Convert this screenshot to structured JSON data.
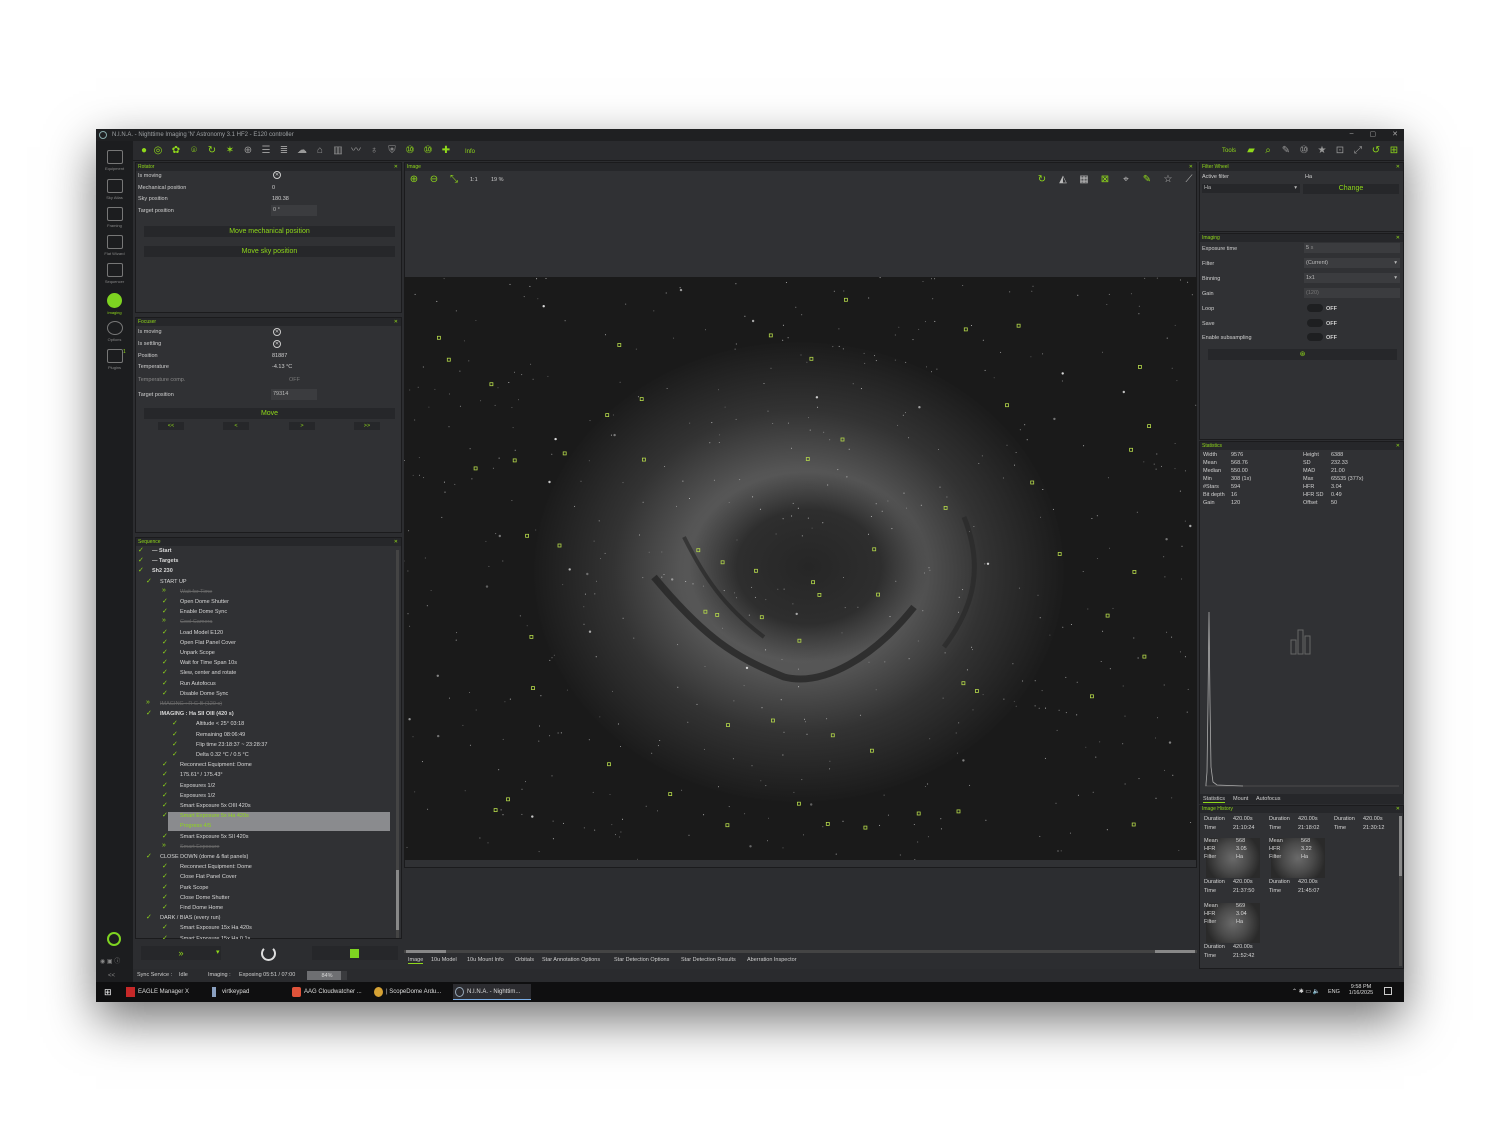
{
  "window": {
    "title": "N.I.N.A. - Nighttime Imaging 'N' Astronomy 3.1 HF2  -  E120 controller"
  },
  "sidebar": {
    "items": [
      {
        "label": "Equipment",
        "icon": "camera-icon"
      },
      {
        "label": "Sky Atlas",
        "icon": "atlas-icon"
      },
      {
        "label": "Framing",
        "icon": "framing-icon"
      },
      {
        "label": "Flat Wizard",
        "icon": "flat-icon"
      },
      {
        "label": "Sequencer",
        "icon": "sequencer-icon"
      },
      {
        "label": "Imaging",
        "icon": "imaging-icon"
      },
      {
        "label": "Options",
        "icon": "gear-icon"
      },
      {
        "label": "Plugins",
        "icon": "puzzle-icon"
      }
    ],
    "plugins_badge": "1"
  },
  "toolbar": {
    "info_label": "Info",
    "tools_label": "Tools"
  },
  "rotator": {
    "title": "Rotator",
    "is_moving_label": "Is moving",
    "mechanical_label": "Mechanical position",
    "mechanical_value": "0",
    "sky_label": "Sky position",
    "sky_value": "180.38",
    "target_label": "Target position",
    "target_value": "0",
    "target_unit": "°",
    "move_mech_btn": "Move mechanical position",
    "move_sky_btn": "Move sky position"
  },
  "focuser": {
    "title": "Focuser",
    "is_moving_label": "Is moving",
    "is_settling_label": "Is settling",
    "position_label": "Position",
    "position_value": "81887",
    "temp_label": "Temperature",
    "temp_value": "-4.13 °C",
    "temp_comp_label": "Temperature comp.",
    "temp_comp_value": "OFF",
    "target_label": "Target position",
    "target_value": "79314",
    "move_btn": "Move",
    "steps": [
      "<<",
      "<",
      ">",
      ">>"
    ]
  },
  "sequence": {
    "title": "Sequence",
    "items": [
      {
        "text": "Start",
        "indent": 0,
        "style": "bold"
      },
      {
        "text": "Targets",
        "indent": 0,
        "style": "bold"
      },
      {
        "text": "Sh2 230",
        "indent": 1,
        "style": "bold"
      },
      {
        "text": "START UP",
        "indent": 2,
        "style": ""
      },
      {
        "text": "Wait for Time",
        "indent": 3,
        "style": "dis"
      },
      {
        "text": "Open Dome Shutter",
        "indent": 3,
        "style": ""
      },
      {
        "text": "Enable Dome Sync",
        "indent": 3,
        "style": ""
      },
      {
        "text": "Cool Camera",
        "indent": 3,
        "style": "dis"
      },
      {
        "text": "Load Model E120",
        "indent": 3,
        "style": ""
      },
      {
        "text": "Open Flat Panel Cover",
        "indent": 3,
        "style": ""
      },
      {
        "text": "Unpark Scope",
        "indent": 3,
        "style": ""
      },
      {
        "text": "Wait for Time Span  10s",
        "indent": 3,
        "style": ""
      },
      {
        "text": "Slew, center and rotate",
        "indent": 3,
        "style": ""
      },
      {
        "text": "Run Autofocus",
        "indent": 3,
        "style": ""
      },
      {
        "text": "Disable Dome Sync",
        "indent": 3,
        "style": ""
      },
      {
        "text": "IMAGING : R G B  (120 s)",
        "indent": 2,
        "style": "dis"
      },
      {
        "text": "IMAGING : Ha SII OIII  (420 s)",
        "indent": 2,
        "style": "bold"
      },
      {
        "text": "Altitude < 25°  03:18",
        "indent": 4,
        "style": ""
      },
      {
        "text": "Remaining  08:06:49",
        "indent": 4,
        "style": ""
      },
      {
        "text": "Flip time  23:18:37 ~ 23:28:37",
        "indent": 4,
        "style": ""
      },
      {
        "text": "Delta  0.32 °C / 0.5 °C",
        "indent": 4,
        "style": ""
      },
      {
        "text": "Reconnect Equipment: Dome",
        "indent": 3,
        "style": ""
      },
      {
        "text": "175.61° / 175.43°",
        "indent": 3,
        "style": ""
      },
      {
        "text": "Exposures  1/2",
        "indent": 3,
        "style": ""
      },
      {
        "text": "Exposures  1/2",
        "indent": 3,
        "style": ""
      },
      {
        "text": "Smart Exposure  5x  OIII  420s",
        "indent": 3,
        "style": ""
      },
      {
        "text": "Smart Exposure  5x  Ha  420s",
        "indent": 3,
        "style": "hl"
      },
      {
        "text": "Progress  4/5",
        "indent": 3,
        "style": "hl2"
      },
      {
        "text": "Smart Exposure  5x  SII  420s",
        "indent": 3,
        "style": ""
      },
      {
        "text": "Smart Exposure",
        "indent": 3,
        "style": "dis"
      },
      {
        "text": "CLOSE DOWN (dome & flat panels)",
        "indent": 2,
        "style": ""
      },
      {
        "text": "Reconnect Equipment: Dome",
        "indent": 3,
        "style": ""
      },
      {
        "text": "Close Flat Panel Cover",
        "indent": 3,
        "style": ""
      },
      {
        "text": "Park Scope",
        "indent": 3,
        "style": ""
      },
      {
        "text": "Close Dome Shutter",
        "indent": 3,
        "style": ""
      },
      {
        "text": "Find Dome Home",
        "indent": 3,
        "style": ""
      },
      {
        "text": "DARK / BIAS (every run)",
        "indent": 2,
        "style": ""
      },
      {
        "text": "Smart Exposure  15x  Ha  420s",
        "indent": 3,
        "style": ""
      },
      {
        "text": "Smart Exposure  15x  Ha  0.1s",
        "indent": 3,
        "style": ""
      }
    ]
  },
  "image_panel": {
    "title": "Image",
    "zoom_1to1": "1:1",
    "zoom_level": "19 %",
    "tabs": [
      "Image",
      "10u Model",
      "10u Mount Info",
      "Orbitals",
      "Star Annotation Options",
      "Star Detection Options",
      "Star Detection Results",
      "Aberration Inspector"
    ]
  },
  "filter_wheel": {
    "title": "Filter Wheel",
    "active_label": "Active filter",
    "active_value": "Ha",
    "select_value": "Ha",
    "change_btn": "Change"
  },
  "imaging": {
    "title": "Imaging",
    "exposure_label": "Exposure time",
    "exposure_value": "5",
    "exposure_unit": "s",
    "filter_label": "Filter",
    "filter_value": "(Current)",
    "binning_label": "Binning",
    "binning_value": "1x1",
    "gain_label": "Gain",
    "gain_value": "(120)",
    "loop_label": "Loop",
    "loop_value": "OFF",
    "save_label": "Save",
    "save_value": "OFF",
    "subsample_label": "Enable subsampling",
    "subsample_value": "OFF"
  },
  "statistics": {
    "title": "Statistics",
    "left": [
      [
        "Width",
        "9576"
      ],
      [
        "Mean",
        "568.76"
      ],
      [
        "Median",
        "550.00"
      ],
      [
        "Min",
        "308 (1x)"
      ],
      [
        "#Stars",
        "594"
      ],
      [
        "Bit depth",
        "16"
      ],
      [
        "Gain",
        "120"
      ]
    ],
    "right": [
      [
        "Height",
        "6388"
      ],
      [
        "SD",
        "232.33"
      ],
      [
        "MAD",
        "21.00"
      ],
      [
        "Max",
        "65535 (377x)"
      ],
      [
        "HFR",
        "3.04"
      ],
      [
        "HFR SD",
        "0.49"
      ],
      [
        "Offset",
        "50"
      ]
    ],
    "tabs": [
      "Statistics",
      "Mount",
      "Autofocus"
    ]
  },
  "image_history": {
    "title": "Image History",
    "cards": [
      {
        "duration": "420.00s",
        "time": "21:10:24"
      },
      {
        "duration": "420.00s",
        "time": "21:18:02"
      },
      {
        "duration": "420.00s",
        "time": "21:30:12"
      },
      {
        "mean": "568",
        "hfr": "3.05",
        "filter": "Ha",
        "duration": "420.00s",
        "time": "21:37:50"
      },
      {
        "mean": "568",
        "hfr": "3.22",
        "filter": "Ha",
        "duration": "420.00s",
        "time": "21:45:07"
      },
      {
        "mean": "569",
        "hfr": "3.04",
        "filter": "Ha",
        "duration": "420.00s",
        "time": "21:52:42"
      }
    ],
    "labels": {
      "duration": "Duration",
      "time": "Time",
      "mean": "Mean",
      "hfr": "HFR",
      "filter": "Filter"
    }
  },
  "statusbar": {
    "sync_label": "Sync Service :",
    "sync_value": "Idle",
    "imaging_label": "Imaging :",
    "imaging_value": "Exposing 05:51 / 07:00",
    "progress_text": "84%",
    "progress": 0.84
  },
  "taskbar": {
    "apps": [
      "EAGLE Manager X",
      "virtkeypad",
      "AAG Cloudwatcher ...",
      "| ScopeDome Ardu...",
      "N.I.N.A. - Nighttim..."
    ],
    "lang": "ENG",
    "time": "9:58 PM",
    "date": "1/16/2025"
  },
  "colors": {
    "accent": "#8fd81a",
    "panel": "#303134",
    "bg": "#2c2d30"
  }
}
